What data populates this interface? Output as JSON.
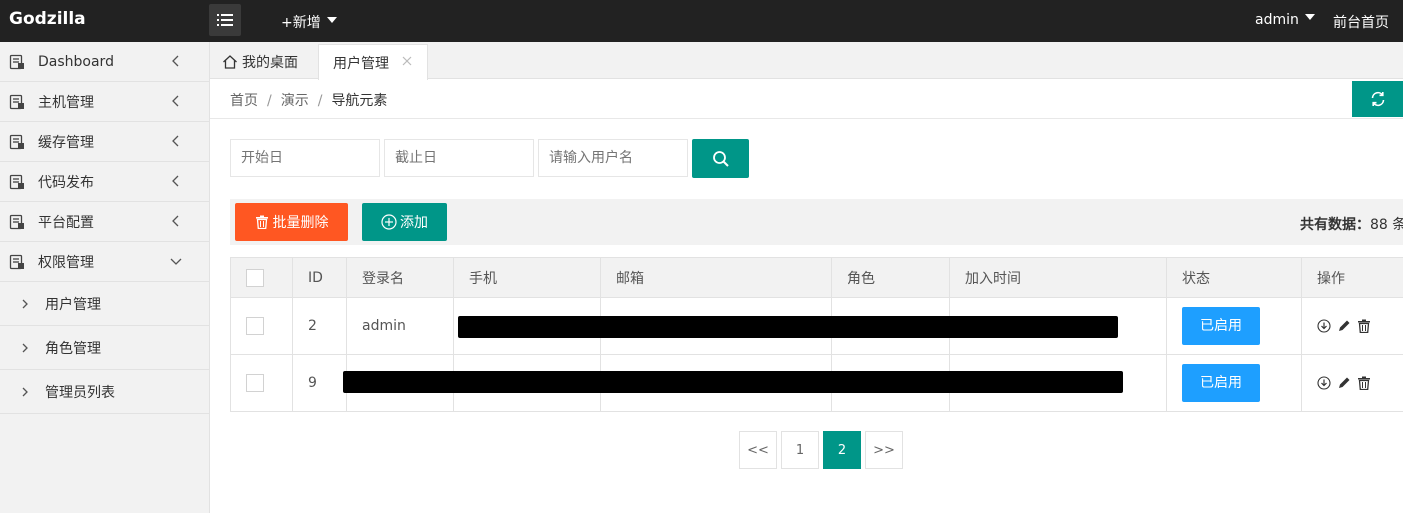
{
  "topbar": {
    "logo": "Godzilla",
    "new_label": "+新增",
    "user_label": "admin",
    "home_label": "前台首页"
  },
  "sidebar": {
    "items": [
      {
        "label": "Dashboard"
      },
      {
        "label": "主机管理"
      },
      {
        "label": "缓存管理"
      },
      {
        "label": "代码发布"
      },
      {
        "label": "平台配置"
      },
      {
        "label": "权限管理"
      }
    ],
    "sub_items": [
      {
        "label": "用户管理"
      },
      {
        "label": "角色管理"
      },
      {
        "label": "管理员列表"
      }
    ]
  },
  "tabs": {
    "home": "我的桌面",
    "active": "用户管理"
  },
  "breadcrumb": {
    "home": "首页",
    "demo": "演示",
    "current": "导航元素"
  },
  "search": {
    "start_placeholder": "开始日",
    "end_placeholder": "截止日",
    "user_placeholder": "请输入用户名"
  },
  "toolbar": {
    "batch_delete": "批量删除",
    "add": "添加",
    "total_label": "共有数据：",
    "total_count": "88",
    "total_unit": "条"
  },
  "table": {
    "headers": [
      "ID",
      "登录名",
      "手机",
      "邮箱",
      "角色",
      "加入时间",
      "状态",
      "操作"
    ],
    "rows": [
      {
        "id": "2",
        "login": "admin",
        "status": "已启用"
      },
      {
        "id": "9",
        "login": "",
        "status": "已启用"
      }
    ]
  },
  "pager": {
    "prev": "<<",
    "pages": [
      "1",
      "2"
    ],
    "current": "2",
    "next": ">>"
  },
  "colors": {
    "teal": "#009688",
    "orange": "#ff5722",
    "blue": "#1e9fff",
    "topbar": "#222222"
  }
}
